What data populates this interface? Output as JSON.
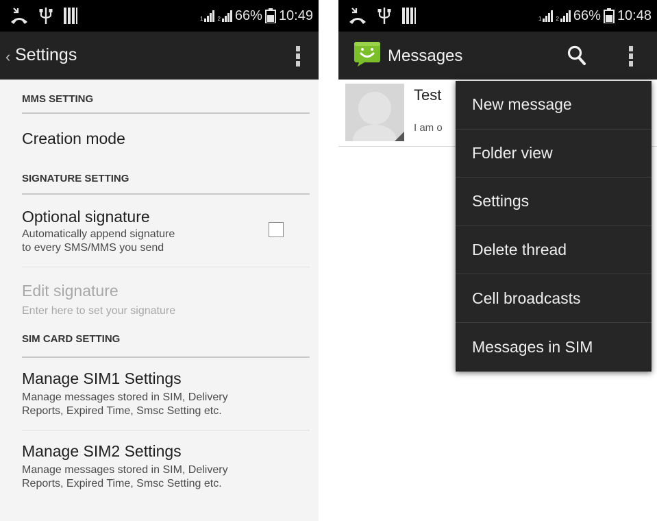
{
  "left_screen": {
    "status_bar": {
      "icons": [
        "missed-call-icon",
        "usb-icon",
        "storage-icon"
      ],
      "battery": "66%",
      "time": "10:49"
    },
    "action_bar": {
      "title": "Settings",
      "back_icon": "‹"
    },
    "sections": [
      {
        "header": "MMS SETTING",
        "items": [
          {
            "title": "Creation mode"
          }
        ]
      },
      {
        "header": "SIGNATURE SETTING",
        "items": [
          {
            "title": "Optional signature",
            "summary": [
              "Automatically append signature",
              "to every SMS/MMS you send"
            ],
            "checked": false
          },
          {
            "title": "Edit signature",
            "summary": [
              "Enter here to set your signature"
            ],
            "enabled": false
          }
        ]
      },
      {
        "header": "SIM CARD SETTING",
        "items": [
          {
            "title": "Manage SIM1 Settings",
            "summary": [
              "Manage messages stored in SIM, Delivery",
              "Reports, Expired Time, Smsc Setting etc."
            ]
          },
          {
            "title": "Manage SIM2 Settings",
            "summary": [
              "Manage messages stored in SIM, Delivery",
              "Reports, Expired Time, Smsc Setting etc."
            ]
          }
        ]
      }
    ]
  },
  "right_screen": {
    "status_bar": {
      "icons": [
        "missed-call-icon",
        "usb-icon",
        "storage-icon"
      ],
      "battery": "66%",
      "time": "10:48"
    },
    "action_bar": {
      "title": "Messages",
      "logo_icon": "messages-logo-icon",
      "search_icon": "search-icon"
    },
    "conversation": {
      "name": "Test",
      "snippet": "I am o"
    },
    "menu": {
      "items": [
        "New message",
        "Folder view",
        "Settings",
        "Delete thread",
        "Cell broadcasts",
        "Messages in SIM"
      ]
    }
  },
  "colors": {
    "action_bar": "#232323",
    "status_bar": "#000000",
    "settings_background": "#f4f4f4",
    "menu_background": "#262626",
    "logo_green": "#7cbf2a"
  }
}
